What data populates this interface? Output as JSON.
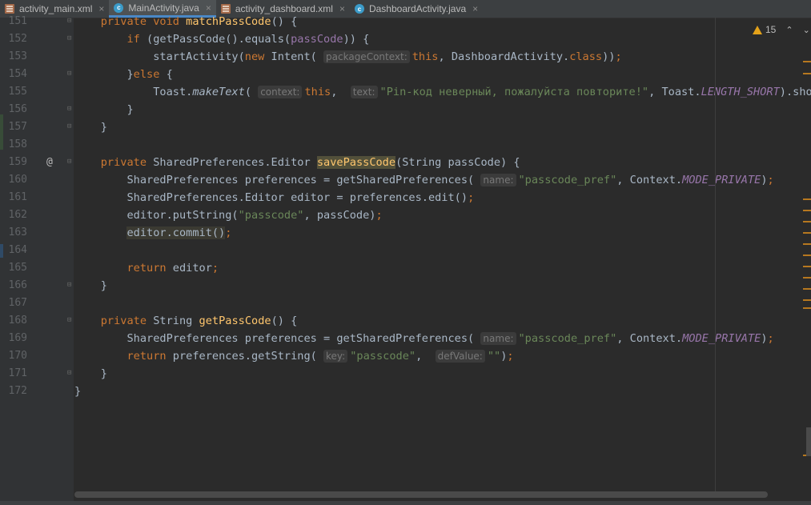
{
  "tabs": [
    {
      "label": "activity_main.xml",
      "type": "xml",
      "active": false
    },
    {
      "label": "MainActivity.java",
      "type": "java",
      "active": true
    },
    {
      "label": "activity_dashboard.xml",
      "type": "xml",
      "active": false
    },
    {
      "label": "DashboardActivity.java",
      "type": "java",
      "active": false
    }
  ],
  "tab_close_glyph": "×",
  "problems": {
    "warning_count": "15"
  },
  "colors": {
    "keyword": "#cc7832",
    "function": "#ffc66d",
    "string": "#6a8759",
    "constant": "#9876aa",
    "text": "#a9b7c6",
    "background": "#2b2b2b"
  },
  "lines": [
    {
      "num": "151",
      "html": "    <span class=\"kw\">private void </span><span class=\"fn\">matchPassCode</span>() {"
    },
    {
      "num": "152",
      "html": "        <span class=\"kw\">if </span>(getPassCode().equals(<span class=\"field\">passCode</span>)) {"
    },
    {
      "num": "153",
      "html": "            startActivity(<span class=\"kw\">new </span>Intent( <span class=\"hint\">packageContext:</span><span class=\"kw\">this</span>, DashboardActivity.<span class=\"kw\">class</span>))<span class=\"kw\">;</span>"
    },
    {
      "num": "154",
      "html": "        }<span class=\"kw\">else </span>{"
    },
    {
      "num": "155",
      "html": "            Toast.<span class=\"ital\">makeText</span>( <span class=\"hint\">context:</span><span class=\"kw\">this</span>,  <span class=\"hint\">text:</span><span class=\"str\">\"Pin-код неверный, пожалуйста повторите!\"</span>, Toast.<span class=\"const\">LENGTH_SHORT</span>).show()<span class=\"kw\">;</span>"
    },
    {
      "num": "156",
      "html": "        }"
    },
    {
      "num": "157",
      "html": "    }"
    },
    {
      "num": "158",
      "html": ""
    },
    {
      "num": "159",
      "html": "    <span class=\"kw\">private </span>SharedPreferences.Editor <span class=\"fn hl\">savePassCode</span>(String passCode) {"
    },
    {
      "num": "160",
      "html": "        SharedPreferences preferences = getSharedPreferences( <span class=\"hint\">name:</span><span class=\"str\">\"passcode_pref\"</span>, Context.<span class=\"const\">MODE_PRIVATE</span>)<span class=\"kw\">;</span>"
    },
    {
      "num": "161",
      "html": "        SharedPreferences.Editor editor = preferences.edit()<span class=\"kw\">;</span>"
    },
    {
      "num": "162",
      "html": "        editor.putString(<span class=\"str\">\"passcode\"</span>, passCode)<span class=\"kw\">;</span>"
    },
    {
      "num": "163",
      "html": "        <span class=\"hl2\">editor.commit()</span><span class=\"kw\">;</span>"
    },
    {
      "num": "164",
      "html": ""
    },
    {
      "num": "165",
      "html": "        <span class=\"kw\">return </span>editor<span class=\"kw\">;</span>"
    },
    {
      "num": "166",
      "html": "    }"
    },
    {
      "num": "167",
      "html": ""
    },
    {
      "num": "168",
      "html": "    <span class=\"kw\">private </span>String <span class=\"fn\">getPassCode</span>() {"
    },
    {
      "num": "169",
      "html": "        SharedPreferences preferences = getSharedPreferences( <span class=\"hint\">name:</span><span class=\"str\">\"passcode_pref\"</span>, Context.<span class=\"const\">MODE_PRIVATE</span>)<span class=\"kw\">;</span>"
    },
    {
      "num": "170",
      "html": "        <span class=\"kw\">return </span>preferences.getString( <span class=\"hint\">key:</span><span class=\"str\">\"passcode\"</span>,  <span class=\"hint\">defValue:</span><span class=\"str\">\"\"</span>)<span class=\"kw\">;</span>"
    },
    {
      "num": "171",
      "html": "    }"
    },
    {
      "num": "172",
      "html": "}"
    }
  ],
  "override_marker": "@"
}
